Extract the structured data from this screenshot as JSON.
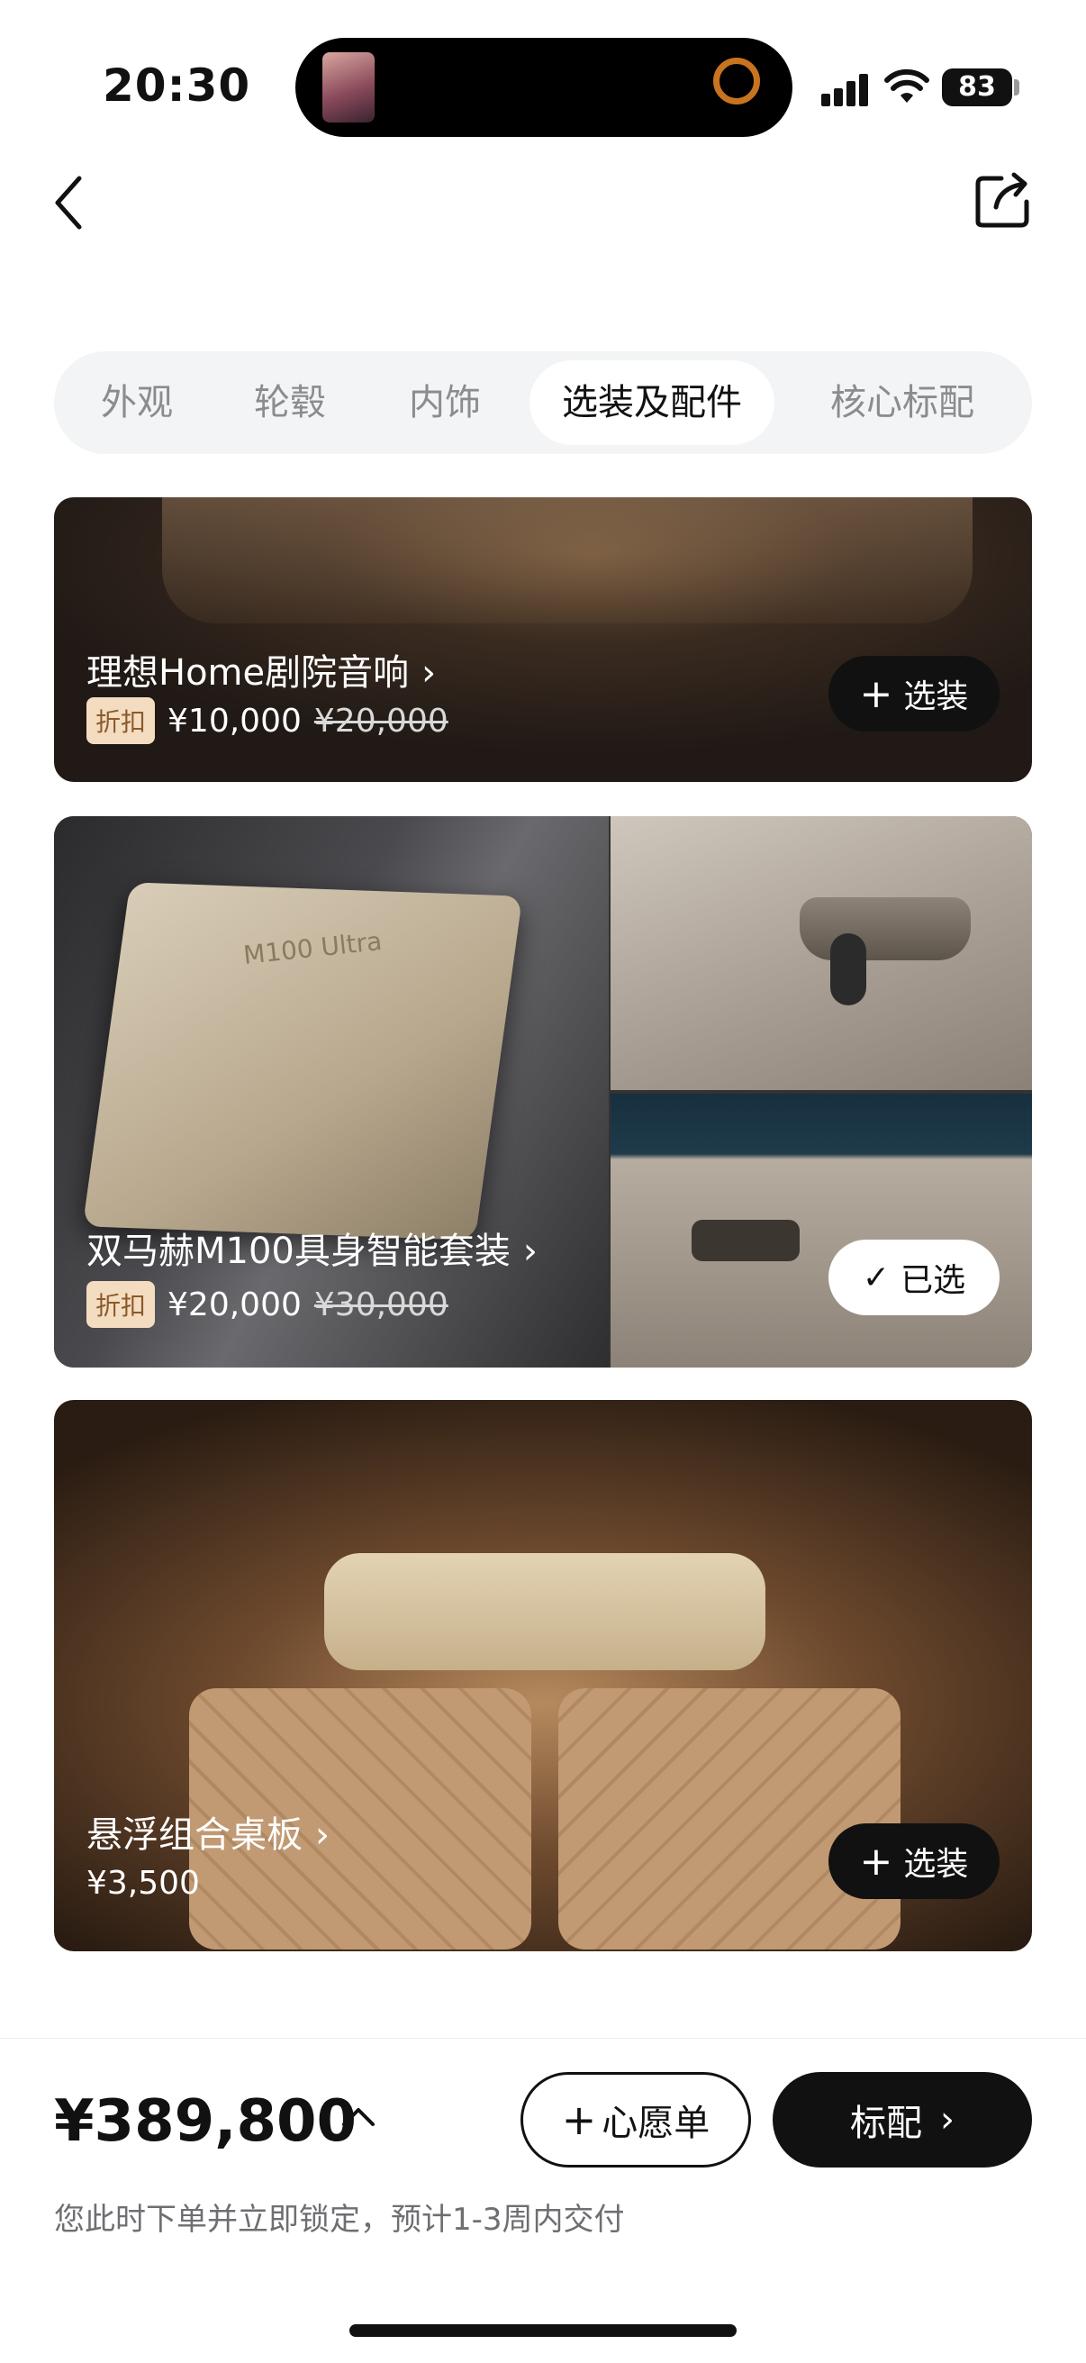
{
  "status_bar": {
    "time": "20:30",
    "battery": "83",
    "icons": [
      "cellular-signal-icon",
      "wifi-icon",
      "battery-icon"
    ]
  },
  "header": {
    "back_icon": "chevron-left-icon",
    "share_icon": "share-icon"
  },
  "tabs": [
    {
      "label": "外观",
      "active": false
    },
    {
      "label": "轮毂",
      "active": false
    },
    {
      "label": "内饰",
      "active": false
    },
    {
      "label": "选装及配件",
      "active": true
    },
    {
      "label": "核心标配",
      "active": false
    }
  ],
  "cards": [
    {
      "title": "理想Home剧院音响",
      "badge": "折扣",
      "price": "¥10,000",
      "original_price": "¥20,000",
      "action_label": "选装",
      "action_state": "add"
    },
    {
      "title": "双马赫M100具身智能套装",
      "chip_label": "M100 Ultra",
      "badge": "折扣",
      "price": "¥20,000",
      "original_price": "¥30,000",
      "action_label": "已选",
      "action_state": "selected"
    },
    {
      "title": "悬浮组合桌板",
      "price": "¥3,500",
      "action_label": "选装",
      "action_state": "add"
    }
  ],
  "bottom_bar": {
    "total_price": "¥389,800",
    "delivery_note": "您此时下单并立即锁定，预计1-3周内交付",
    "wishlist_label": "心愿单",
    "standard_label": "标配"
  },
  "colors": {
    "accent_dark": "#111111",
    "discount_badge_bg": "#f4dcc0",
    "discount_badge_text": "#8a5a2c",
    "tab_bar_bg": "#f3f4f5"
  }
}
